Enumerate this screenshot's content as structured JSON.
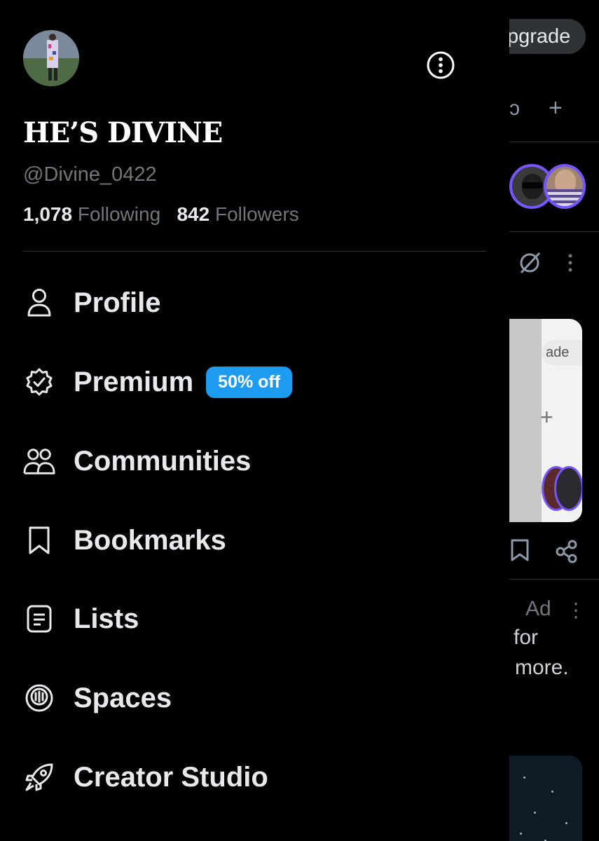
{
  "account": {
    "display_name": "HE’S DIVINE",
    "handle": "@Divine_0422",
    "following_count": "1,078",
    "following_label": "Following",
    "followers_count": "842",
    "followers_label": "Followers"
  },
  "menu": {
    "items": [
      {
        "label": "Profile",
        "icon": "person-icon"
      },
      {
        "label": "Premium",
        "icon": "verified-badge-icon",
        "badge": "50% off"
      },
      {
        "label": "Communities",
        "icon": "communities-icon"
      },
      {
        "label": "Bookmarks",
        "icon": "bookmark-icon"
      },
      {
        "label": "Lists",
        "icon": "list-icon"
      },
      {
        "label": "Spaces",
        "icon": "spaces-icon"
      },
      {
        "label": "Creator Studio",
        "icon": "rocket-icon"
      }
    ]
  },
  "background": {
    "upgrade_label": "pgrade",
    "card_pill": "ade",
    "ad_label": "Ad",
    "ad_text_line1": "for",
    "ad_text_line2": "more."
  },
  "colors": {
    "accent": "#1d9bf0",
    "background": "#000000",
    "muted_text": "#71767b",
    "ring": "#7856ff"
  }
}
